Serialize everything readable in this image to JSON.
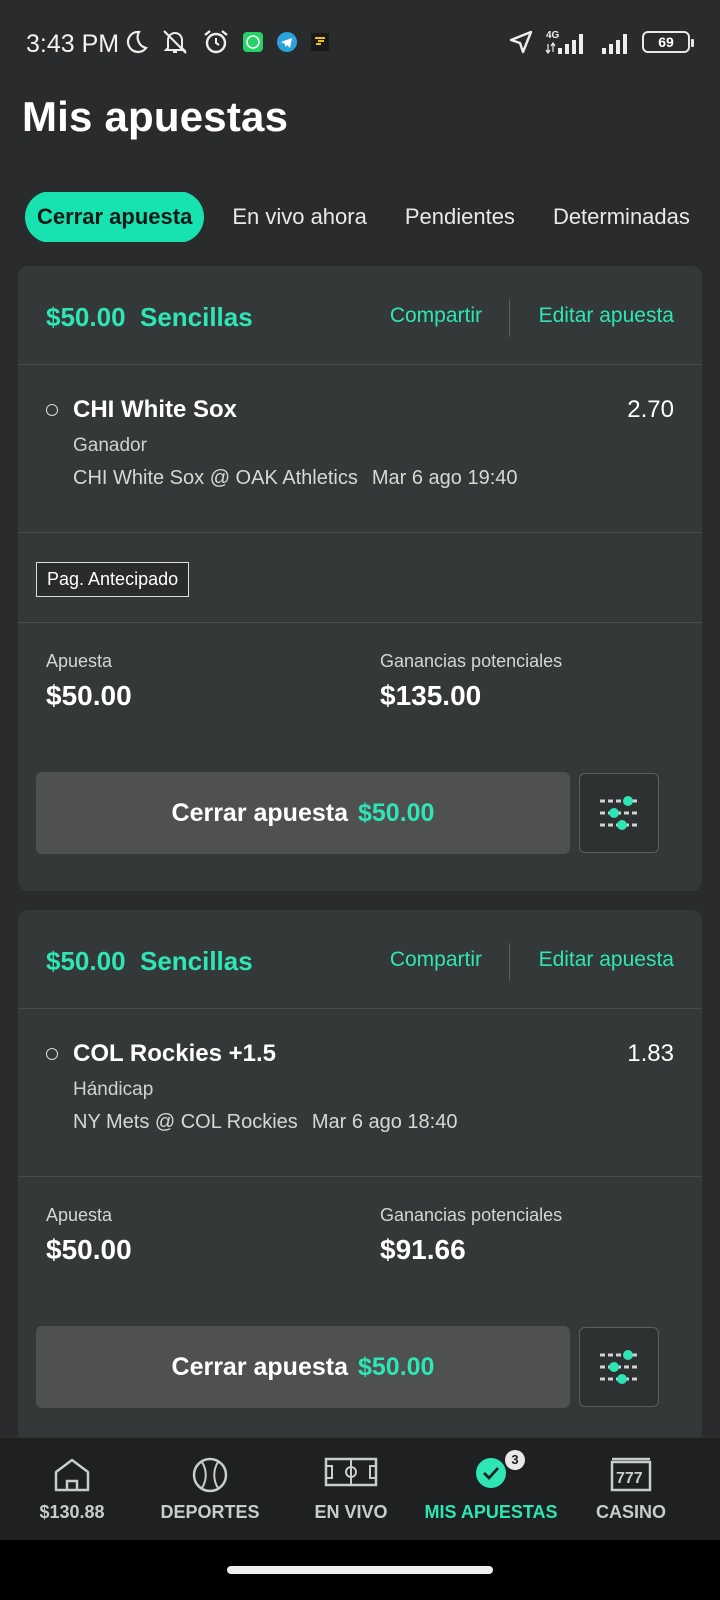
{
  "status_bar": {
    "time": "3:43 PM",
    "network": "4G",
    "battery": "69",
    "left_icons": [
      "moon-icon",
      "muted-bell-icon",
      "alarm-icon",
      "whatsapp-icon",
      "telegram-icon",
      "app-icon"
    ],
    "right_icons": [
      "location-arrow-icon",
      "signal-4g-icon",
      "signal-icon",
      "battery-icon"
    ]
  },
  "page": {
    "title": "Mis apuestas"
  },
  "tabs": [
    {
      "label": "Cerrar apuesta",
      "active": true
    },
    {
      "label": "En vivo ahora",
      "active": false
    },
    {
      "label": "Pendientes",
      "active": false
    },
    {
      "label": "Determinadas",
      "active": false
    }
  ],
  "bets": [
    {
      "header": {
        "stake_type": "$50.00  Sencillas",
        "share": "Compartir",
        "edit": "Editar apuesta"
      },
      "selection": "CHI White Sox",
      "odds": "2.70",
      "market": "Ganador",
      "event": "CHI White Sox @ OAK Athletics",
      "event_time": "Mar 6 ago 19:40",
      "badge": "Pag. Antecipado",
      "stake_label": "Apuesta",
      "stake_value": "$50.00",
      "potential_label": "Ganancias potenciales",
      "potential_value": "$135.00",
      "cashout_label": "Cerrar apuesta",
      "cashout_amount": "$50.00"
    },
    {
      "header": {
        "stake_type": "$50.00  Sencillas",
        "share": "Compartir",
        "edit": "Editar apuesta"
      },
      "selection": "COL Rockies +1.5",
      "odds": "1.83",
      "market": "Hándicap",
      "event": "NY Mets @ COL Rockies",
      "event_time": "Mar 6 ago 18:40",
      "stake_label": "Apuesta",
      "stake_value": "$50.00",
      "potential_label": "Ganancias potenciales",
      "potential_value": "$91.66",
      "cashout_label": "Cerrar apuesta",
      "cashout_amount": "$50.00"
    }
  ],
  "bottom_nav": [
    {
      "label": "$130.88",
      "icon": "home-icon",
      "active": false
    },
    {
      "label": "DEPORTES",
      "icon": "baseball-icon",
      "active": false
    },
    {
      "label": "EN VIVO",
      "icon": "field-icon",
      "active": false
    },
    {
      "label": "MIS APUESTAS",
      "icon": "check-circle-icon",
      "active": true,
      "badge": "3"
    },
    {
      "label": "CASINO",
      "icon": "slot-machine-icon",
      "active": false
    }
  ],
  "colors": {
    "accent": "#2ee6b5",
    "tab_active": "#18e2b0",
    "background": "#2a2b2c",
    "card": "#353838"
  }
}
